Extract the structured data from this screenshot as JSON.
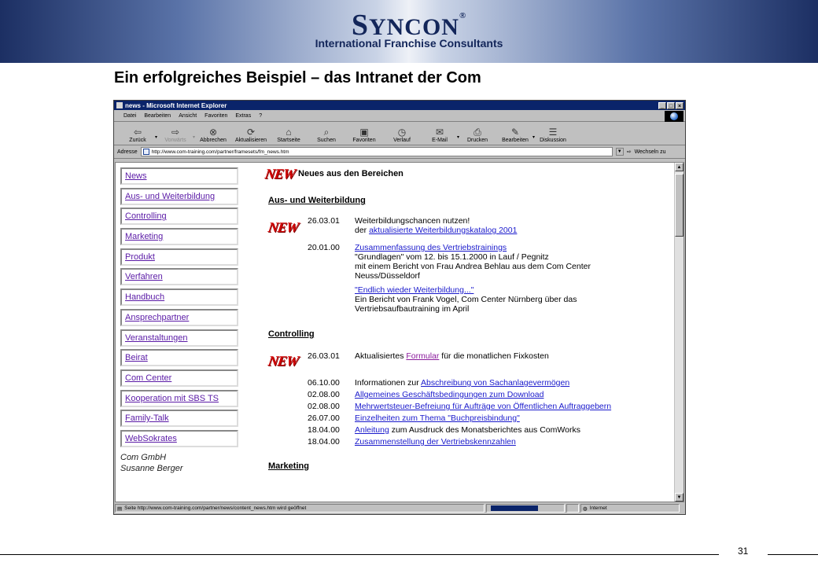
{
  "slide": {
    "logo_initial": "S",
    "logo_rest": "YNCON",
    "logo_reg": "®",
    "logo_subtitle": "International Franchise Consultants",
    "title": "Ein erfolgreiches Beispiel – das Intranet der Com",
    "page_number": "31"
  },
  "browser": {
    "window_title": "news - Microsoft Internet Explorer",
    "window_buttons": [
      "_",
      "□",
      "×"
    ],
    "menu": [
      "Datei",
      "Bearbeiten",
      "Ansicht",
      "Favoriten",
      "Extras",
      "?"
    ],
    "toolbar": [
      {
        "label": "Zurück",
        "icon": "back-arrow-icon",
        "glyph": "⇦",
        "dropdown": true,
        "disabled": false
      },
      {
        "label": "Vorwärts",
        "icon": "forward-arrow-icon",
        "glyph": "⇨",
        "dropdown": true,
        "disabled": true
      },
      {
        "label": "Abbrechen",
        "icon": "stop-icon",
        "glyph": "⊗",
        "dropdown": false,
        "disabled": false
      },
      {
        "label": "Aktualisieren",
        "icon": "refresh-icon",
        "glyph": "⟳",
        "dropdown": false,
        "disabled": false
      },
      {
        "label": "Startseite",
        "icon": "home-icon",
        "glyph": "⌂",
        "dropdown": false,
        "disabled": false
      },
      {
        "label": "Suchen",
        "icon": "search-icon",
        "glyph": "⌕",
        "dropdown": false,
        "disabled": false
      },
      {
        "label": "Favoriten",
        "icon": "favorites-folder-icon",
        "glyph": "▣",
        "dropdown": false,
        "disabled": false
      },
      {
        "label": "Verlauf",
        "icon": "history-icon",
        "glyph": "◷",
        "dropdown": false,
        "disabled": false
      },
      {
        "label": "E-Mail",
        "icon": "mail-icon",
        "glyph": "✉",
        "dropdown": true,
        "disabled": false
      },
      {
        "label": "Drucken",
        "icon": "printer-icon",
        "glyph": "⎙",
        "dropdown": false,
        "disabled": false
      },
      {
        "label": "Bearbeiten",
        "icon": "edit-icon",
        "glyph": "✎",
        "dropdown": true,
        "disabled": false
      },
      {
        "label": "Diskussion",
        "icon": "discussion-icon",
        "glyph": "☰",
        "dropdown": false,
        "disabled": false
      }
    ],
    "address_label": "Adresse",
    "address_url": "http://www.com-training.com/partner/framesets/fm_news.htm",
    "go_label": "Wechseln zu",
    "status_text": "Seite http://www.com-training.com/partner/news/content_news.htm wird geöffnet",
    "status_zone": "Internet"
  },
  "nav": {
    "items": [
      "News",
      "Aus- und Weiterbildung",
      "Controlling",
      "Marketing",
      "Produkt",
      "Verfahren",
      "Handbuch",
      "Ansprechpartner",
      "Veranstaltungen",
      "Beirat",
      "Com Center",
      "Kooperation mit SBS TS",
      "Family-Talk",
      "WebSokrates"
    ],
    "company": "Com GmbH",
    "person": "Susanne Berger"
  },
  "main": {
    "badge": "NEW",
    "heading": "Neues aus den Bereichen",
    "sections": {
      "weiterbildung": "Aus- und Weiterbildung",
      "controlling": "Controlling",
      "marketing": "Marketing"
    },
    "wb_entries": [
      {
        "date": "26.03.01",
        "line1": "Weiterbildungschancen nutzen!",
        "pre": "der ",
        "link": "aktualisierte Weiterbildungskatalog 2001"
      },
      {
        "date": "20.01.00",
        "link": "Zusammenfassung des Vertriebstrainings",
        "lines": [
          "\"Grundlagen\" vom 12. bis 15.1.2000 in Lauf / Pegnitz",
          "mit einem Bericht von Frau Andrea Behlau aus dem Com Center",
          "Neuss/Düsseldorf"
        ]
      },
      {
        "link": "\"Endlich wieder Weiterbildung...\"",
        "lines": [
          "Ein Bericht von Frank Vogel, Com Center Nürnberg über das",
          "Vertriebsaufbautraining im April"
        ]
      }
    ],
    "ctrl_first": {
      "date": "26.03.01",
      "pre": "Aktualisiertes ",
      "link": "Formular",
      "post": " für die monatlichen Fixkosten"
    },
    "ctrl_entries": [
      {
        "date": "06.10.00",
        "pre": "Informationen zur ",
        "link": "Abschreibung von Sachanlagevermögen",
        "post": ""
      },
      {
        "date": "02.08.00",
        "pre": "",
        "link": "Allgemeines Geschäftsbedingungen  zum Download",
        "post": ""
      },
      {
        "date": "02.08.00",
        "pre": "",
        "link": "Mehrwertsteuer-Befreiung für Aufträge von Öffentlichen Auftraggebern",
        "post": ""
      },
      {
        "date": "26.07.00",
        "pre": "",
        "link": "Einzelheiten zum Thema \"Buchpreisbindung\"",
        "post": ""
      },
      {
        "date": "18.04.00",
        "pre": "",
        "link": "Anleitung",
        "post": " zum Ausdruck des Monatsberichtes aus ComWorks"
      },
      {
        "date": "18.04.00",
        "pre": "",
        "link": "Zusammenstellung der Vertriebskennzahlen",
        "post": ""
      }
    ]
  }
}
